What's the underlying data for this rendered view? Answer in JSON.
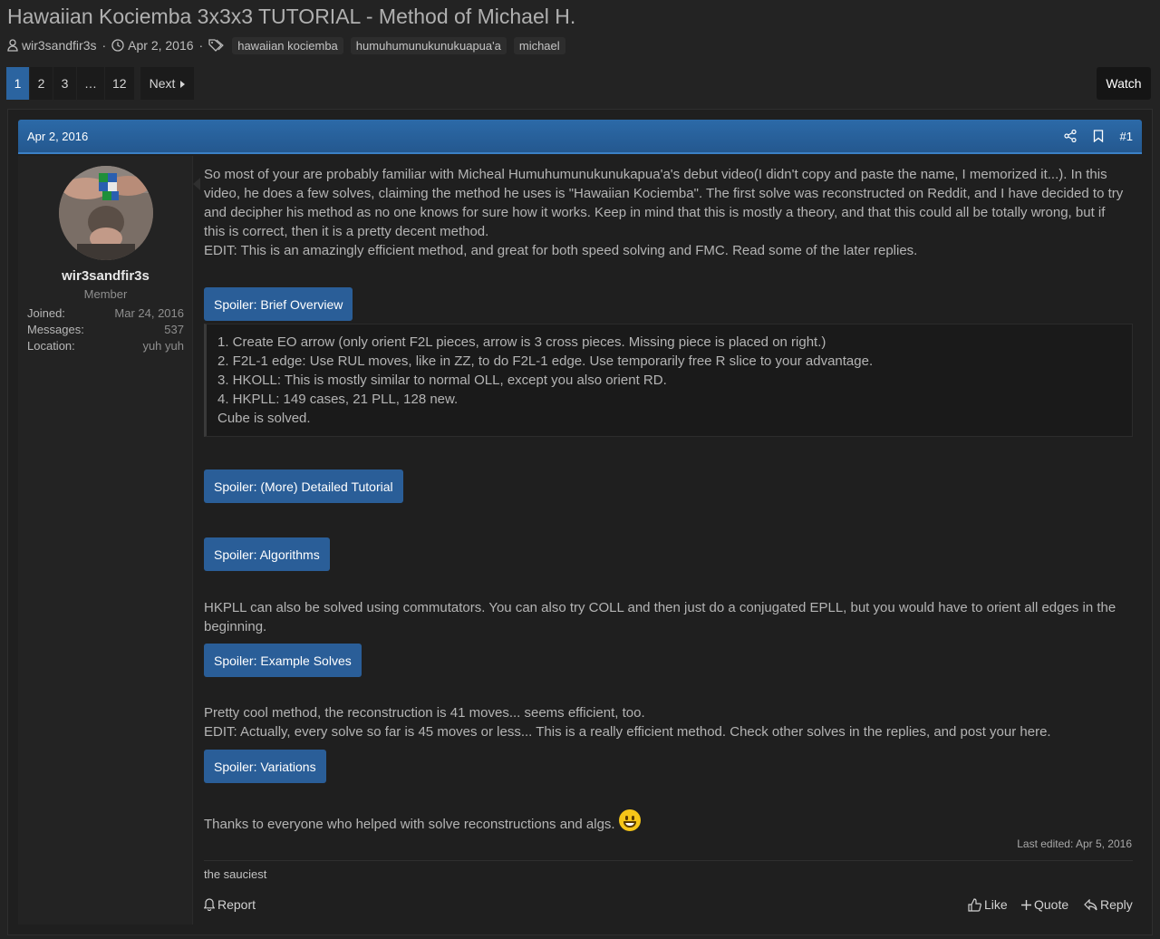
{
  "thread": {
    "title": "Hawaiian Kociemba 3x3x3 TUTORIAL - Method of Michael H.",
    "author": "wir3sandfir3s",
    "date": "Apr 2, 2016",
    "sep1": "·",
    "sep2": "·",
    "tags": [
      "hawaiian kociemba",
      "humuhumunukunukuapua'a",
      "michael"
    ]
  },
  "pagination": {
    "pages": [
      "1",
      "2",
      "3",
      "…",
      "12"
    ],
    "next_label": "Next",
    "watch_label": "Watch"
  },
  "post": {
    "date": "Apr 2, 2016",
    "number": "#1",
    "user": {
      "name": "wir3sandfir3s",
      "title": "Member",
      "stats": [
        {
          "label": "Joined:",
          "value": "Mar 24, 2016"
        },
        {
          "label": "Messages:",
          "value": "537"
        },
        {
          "label": "Location:",
          "value": "yuh yuh"
        }
      ]
    },
    "intro_lines": [
      "So most of your are probably familiar with Micheal Humuhumunukunukapua'a's debut video(I didn't copy and paste the name, I memorized it...). In this",
      "video, he does a few solves, claiming the method he uses is \"Hawaiian Kociemba\". The first solve was reconstructed on Reddit, and I have decided to try",
      "and decipher his method as no one knows for sure how it works. Keep in mind that this is mostly a theory, and that this could all be totally wrong, but if",
      "this is correct, then it is a pretty decent method.",
      "EDIT: This is an amazingly efficient method, and great for both speed solving and FMC. Read some of the later replies."
    ],
    "spoilers": {
      "overview": "Spoiler: Brief Overview",
      "detailed": "Spoiler: (More) Detailed Tutorial",
      "algorithms": "Spoiler: Algorithms",
      "examples": "Spoiler: Example Solves",
      "variations": "Spoiler: Variations"
    },
    "overview_lines": [
      "1. Create EO arrow (only orient F2L pieces, arrow is 3 cross pieces. Missing piece is placed on right.)",
      "2. F2L-1 edge: Use RUL moves, like in ZZ, to do F2L-1 edge. Use temporarily free R slice to your advantage.",
      "3. HKOLL: This is mostly similar to normal OLL, except you also orient RD.",
      "4. HKPLL: 149 cases, 21 PLL, 128 new.",
      "Cube is solved."
    ],
    "hkpll_lines": [
      "HKPLL can also be solved using commutators. You can also try COLL and then just do a conjugated EPLL, but you would have to orient all edges in the",
      "beginning."
    ],
    "cool_lines": [
      "Pretty cool method, the reconstruction is 41 moves... seems efficient, too.",
      "EDIT: Actually, every solve so far is 45 moves or less... This is a really efficient method. Check other solves in the replies, and post your here."
    ],
    "thanks": "Thanks to everyone who helped with solve reconstructions and algs.",
    "last_edited": "Last edited: Apr 5, 2016",
    "signature": "the sauciest",
    "actions": {
      "report": "Report",
      "like": "Like",
      "quote": "Quote",
      "reply": "Reply"
    }
  },
  "colors": {
    "accent": "#2b64a0",
    "header": "#2c6aa8",
    "background": "#232323"
  }
}
